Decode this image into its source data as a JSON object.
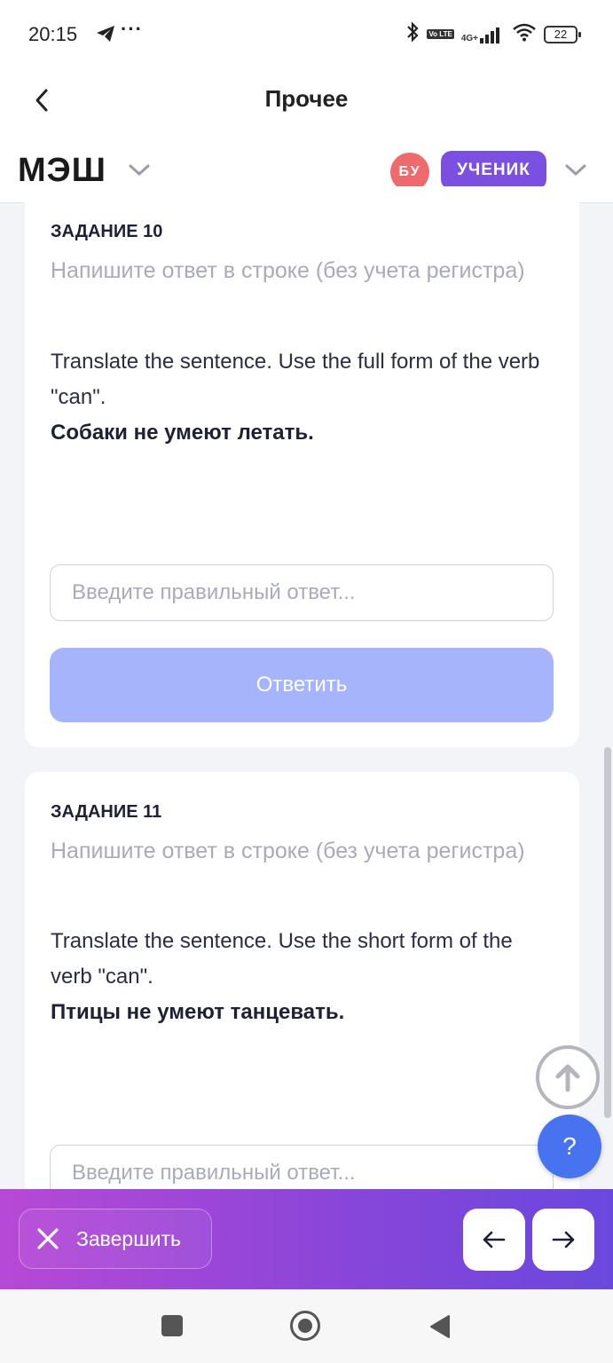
{
  "status_bar": {
    "time": "20:15",
    "more": "···",
    "volte": "Vo LTE",
    "network": "4G+",
    "battery": "22"
  },
  "app_bar": {
    "title": "Прочее"
  },
  "header": {
    "logo": "МЭШ",
    "avatar_initials": "БУ",
    "role": "УЧЕНИК"
  },
  "tasks": [
    {
      "title": "ЗАДАНИЕ 10",
      "hint": "Напишите ответ в строке (без учета регистра)",
      "instruction": "Translate the sentence. Use the full form of the verb \"can\".",
      "sentence": "Собаки не умеют летать.",
      "placeholder": "Введите правильный ответ...",
      "submit_label": "Ответить"
    },
    {
      "title": "ЗАДАНИЕ 11",
      "hint": "Напишите ответ в строке (без учета регистра)",
      "instruction": "Translate the sentence. Use the short form of the verb \"can\".",
      "sentence": "Птицы не умеют танцевать.",
      "placeholder": "Введите правильный ответ..."
    }
  ],
  "fab": {
    "help_label": "?"
  },
  "bottom_bar": {
    "finish_label": "Завершить"
  },
  "colors": {
    "accent_purple": "#7b4fe0",
    "avatar_red": "#ef6b6b",
    "submit_disabled": "#a5b4fb",
    "help_blue": "#4773f0"
  }
}
